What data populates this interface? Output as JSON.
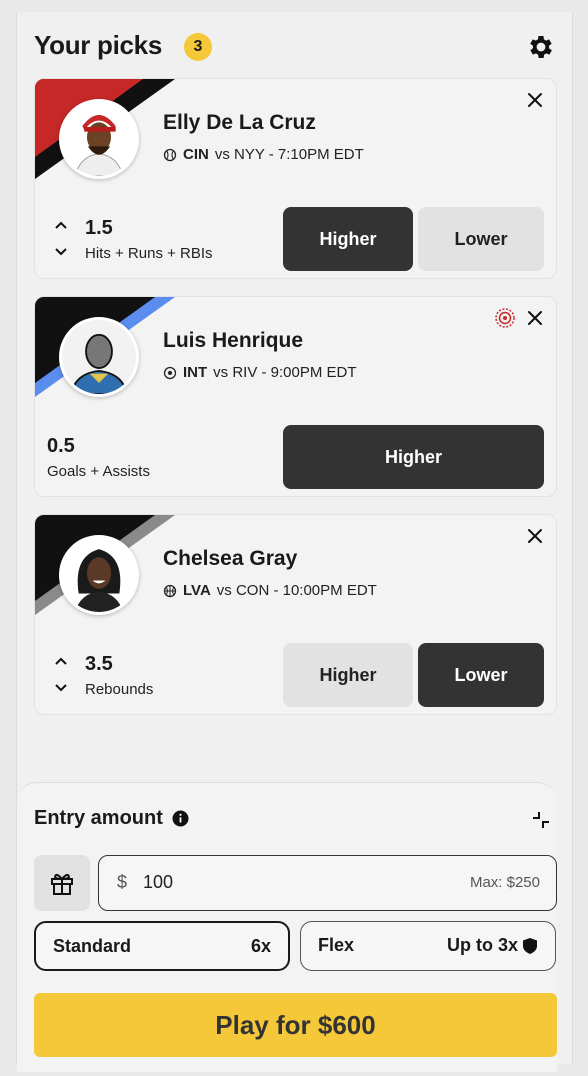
{
  "header": {
    "title": "Your picks",
    "count": "3"
  },
  "picks": [
    {
      "player": "Elly De La Cruz",
      "team": "CIN",
      "matchup": "vs NYY - 7:10PM EDT",
      "sport_icon": "baseball-icon",
      "line": "1.5",
      "stat": "Hits + Runs + RBIs",
      "higher_label": "Higher",
      "lower_label": "Lower",
      "selected": "Higher",
      "stripe_color": "#c62828"
    },
    {
      "player": "Luis Henrique",
      "team": "INT",
      "matchup": "vs RIV - 9:00PM EDT",
      "sport_icon": "soccer-ball-icon",
      "line": "0.5",
      "stat": "Goals + Assists",
      "higher_label": "Higher",
      "selected": "Higher",
      "stripe_color": "#5b8def"
    },
    {
      "player": "Chelsea Gray",
      "team": "LVA",
      "matchup": "vs CON - 10:00PM EDT",
      "sport_icon": "basketball-icon",
      "line": "3.5",
      "stat": "Rebounds",
      "higher_label": "Higher",
      "lower_label": "Lower",
      "selected": "Lower",
      "stripe_color": "#8a8a8a"
    }
  ],
  "entry": {
    "label": "Entry amount",
    "currency": "$",
    "amount": "100",
    "max": "Max: $250",
    "options": [
      {
        "label": "Standard",
        "value": "6x",
        "selected": true
      },
      {
        "label": "Flex",
        "value": "Up to 3x",
        "selected": false
      }
    ],
    "play_label": "Play for $600"
  },
  "colors": {
    "accent": "#f5c83a",
    "dark_button": "#333333",
    "light_button": "#e2e2e2"
  }
}
